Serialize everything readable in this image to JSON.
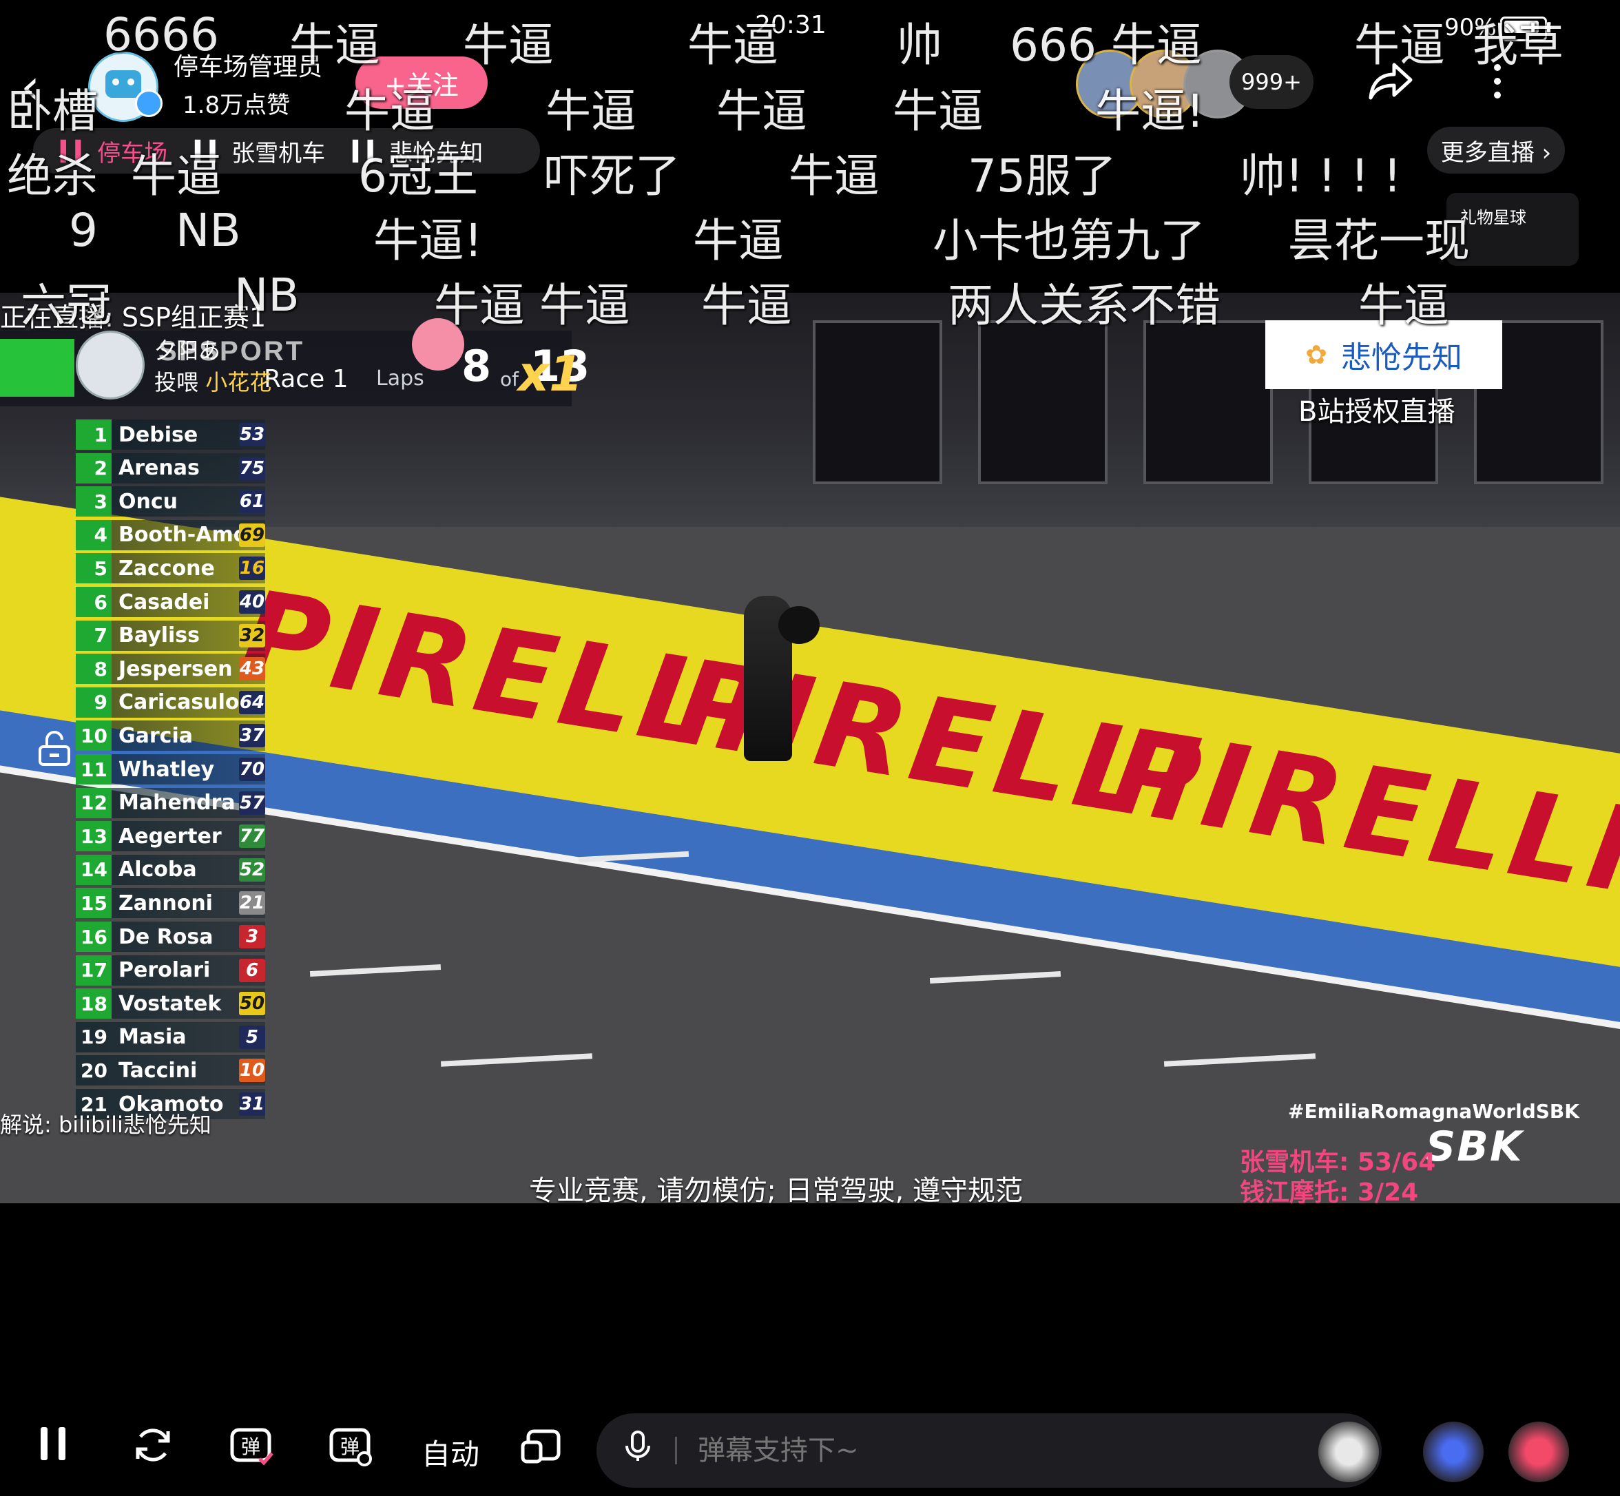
{
  "status_bar": {
    "time": "20:31",
    "battery": "90%"
  },
  "header": {
    "anchor_name": "停车场管理员",
    "likes": "1.8万点赞",
    "follow_label": "+关注",
    "viewer_count": "999+"
  },
  "tabs": [
    {
      "label": "停车场",
      "active": true
    },
    {
      "label": "张雪机车",
      "active": false
    },
    {
      "label": "悲怆先知",
      "active": false
    }
  ],
  "more_live_label": "更多直播 ›",
  "gift_planet": {
    "title": "礼物星球"
  },
  "danmaku": [
    "6666",
    "牛逼",
    "牛逼",
    "牛逼",
    "帅",
    "666 牛逼",
    "牛逼",
    "我草",
    "卧槽",
    "牛逼",
    "牛逼",
    "牛逼",
    "牛逼",
    "牛逼!",
    "绝杀",
    "牛逼",
    "6冠王",
    "吓死了",
    "牛逼",
    "75服了",
    "帅! ! ! !",
    "9",
    "NB",
    "牛逼!",
    "牛逼",
    "小卡也第九了",
    "昙花一现",
    "六冠",
    "NB",
    "牛逼 牛逼",
    "牛逼",
    "两人关系不错",
    "牛逼"
  ],
  "gift_toast": {
    "user": "夕阳あ",
    "action": "投喂",
    "gift": "小花花",
    "count": "x1"
  },
  "video": {
    "now_live": "正在直播: SSP组正赛1",
    "race_header": {
      "brand": "SPSPORT",
      "race": "Race 1",
      "laps_label": "Laps",
      "lap": "8",
      "of": "of",
      "total": "13"
    },
    "leaderboard": [
      {
        "pos": "1",
        "name": "Debise",
        "num": "53",
        "num_bg": "#1f2a5a",
        "num_fg": "#ffffff"
      },
      {
        "pos": "2",
        "name": "Arenas",
        "num": "75",
        "num_bg": "#1f2a5a",
        "num_fg": "#ffffff"
      },
      {
        "pos": "3",
        "name": "Oncu",
        "num": "61",
        "num_bg": "#1f2a5a",
        "num_fg": "#ffffff"
      },
      {
        "pos": "4",
        "name": "Booth-Amos",
        "num": "69",
        "num_bg": "#e8c91a",
        "num_fg": "#1a1a1a"
      },
      {
        "pos": "5",
        "name": "Zaccone",
        "num": "16",
        "num_bg": "#1f2a5a",
        "num_fg": "#f2c21b"
      },
      {
        "pos": "6",
        "name": "Casadei",
        "num": "40",
        "num_bg": "#1f2a5a",
        "num_fg": "#ffffff"
      },
      {
        "pos": "7",
        "name": "Bayliss",
        "num": "32",
        "num_bg": "#e8c91a",
        "num_fg": "#1a1a1a"
      },
      {
        "pos": "8",
        "name": "Jespersen",
        "num": "43",
        "num_bg": "#e05a1c",
        "num_fg": "#ffffff"
      },
      {
        "pos": "9",
        "name": "Caricasulo",
        "num": "64",
        "num_bg": "#1f2a5a",
        "num_fg": "#ffffff"
      },
      {
        "pos": "10",
        "name": "Garcia",
        "num": "37",
        "num_bg": "#1f2a5a",
        "num_fg": "#ffffff"
      },
      {
        "pos": "11",
        "name": "Whatley",
        "num": "70",
        "num_bg": "#1f2a5a",
        "num_fg": "#ffffff"
      },
      {
        "pos": "12",
        "name": "Mahendra",
        "num": "57",
        "num_bg": "#1f2a5a",
        "num_fg": "#ffffff"
      },
      {
        "pos": "13",
        "name": "Aegerter",
        "num": "77",
        "num_bg": "#2e8b3a",
        "num_fg": "#ffffff"
      },
      {
        "pos": "14",
        "name": "Alcoba",
        "num": "52",
        "num_bg": "#2e8b3a",
        "num_fg": "#ffffff"
      },
      {
        "pos": "15",
        "name": "Zannoni",
        "num": "21",
        "num_bg": "#8a8a8a",
        "num_fg": "#ffffff"
      },
      {
        "pos": "16",
        "name": "De Rosa",
        "num": "3",
        "num_bg": "#c8262e",
        "num_fg": "#ffffff"
      },
      {
        "pos": "17",
        "name": "Perolari",
        "num": "6",
        "num_bg": "#c8262e",
        "num_fg": "#ffffff"
      },
      {
        "pos": "18",
        "name": "Vostatek",
        "num": "50",
        "num_bg": "#e8c91a",
        "num_fg": "#1a1a1a"
      },
      {
        "pos": "19",
        "name": "Masia",
        "num": "5",
        "num_bg": "#1f2a5a",
        "num_fg": "#ffffff"
      },
      {
        "pos": "20",
        "name": "Taccini",
        "num": "10",
        "num_bg": "#e05a1c",
        "num_fg": "#ffffff"
      },
      {
        "pos": "21",
        "name": "Okamoto",
        "num": "31",
        "num_bg": "#1f2a5a",
        "num_fg": "#ffffff"
      }
    ],
    "brand_box_text": "悲怆先知",
    "auth_text": "B站授权直播",
    "hashtag": "#EmiliaRomagnaWorldSBK",
    "sbk_logo": "SBK",
    "sponsor_lines": [
      "张雪机车: 53/64",
      "钱江摩托: 3/24"
    ],
    "commentary": "解说: bilibili悲怆先知",
    "warning": "专业竞赛, 请勿模仿; 日常驾驶, 遵守规范",
    "billboard_text": "PIRELLI"
  },
  "controls": {
    "auto_label": "自动",
    "input_placeholder": "弹幕支持下~"
  },
  "colors": {
    "accent_pink": "#f8648c",
    "tab_active": "#f4508a",
    "scoreboard_green": "#1ea933"
  }
}
